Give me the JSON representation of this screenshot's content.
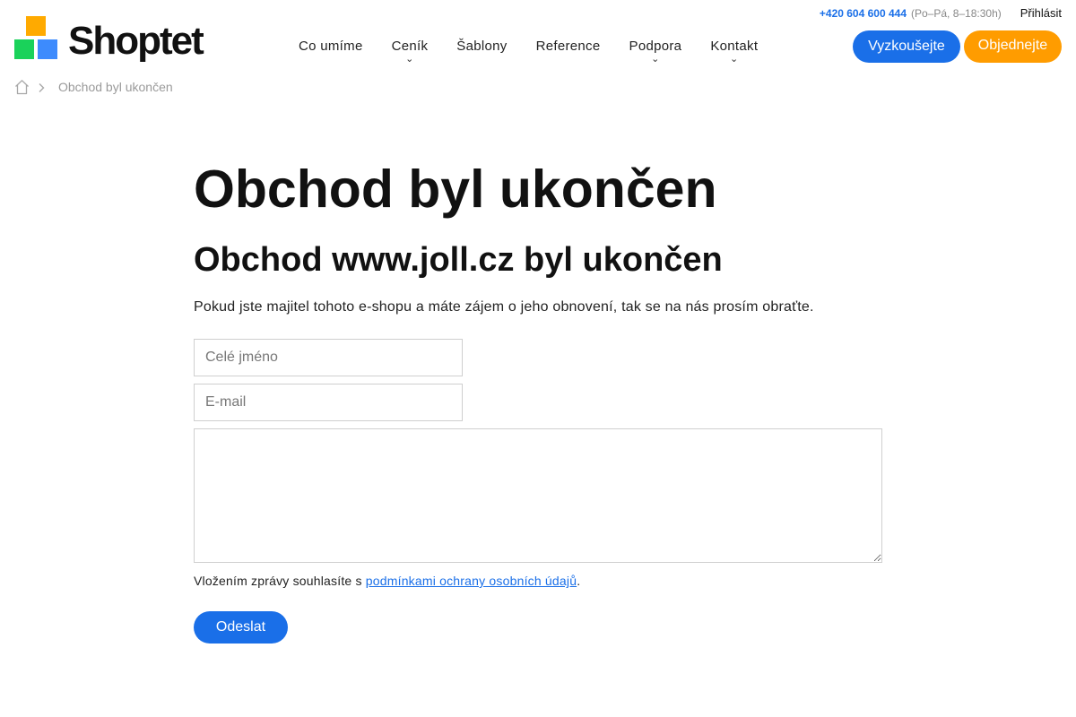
{
  "header": {
    "phone": "+420 604 600 444",
    "hours": "(Po–Pá, 8–18:30h)",
    "login": "Přihlásit",
    "logo_text": "Shoptet",
    "try_button": "Vyzkoušejte",
    "order_button": "Objednejte",
    "brand_colors": {
      "orange": "#ffaa00",
      "green": "#1ad25a",
      "blue": "#3d8bfd"
    }
  },
  "nav": {
    "items": [
      {
        "label": "Co umíme",
        "has_dropdown": false
      },
      {
        "label": "Ceník",
        "has_dropdown": true
      },
      {
        "label": "Šablony",
        "has_dropdown": false
      },
      {
        "label": "Reference",
        "has_dropdown": false
      },
      {
        "label": "Podpora",
        "has_dropdown": true
      },
      {
        "label": "Kontakt",
        "has_dropdown": true
      }
    ]
  },
  "breadcrumb": {
    "home_icon": "home-icon",
    "current": "Obchod byl ukončen"
  },
  "main": {
    "title": "Obchod byl ukončen",
    "subtitle": "Obchod www.joll.cz byl ukončen",
    "intro": "Pokud jste majitel tohoto e-shopu a máte zájem o jeho obnovení, tak se na nás prosím obraťte.",
    "form": {
      "name_placeholder": "Celé jméno",
      "name_value": "",
      "email_placeholder": "E-mail",
      "email_value": "",
      "message_value": "",
      "consent_prefix": "Vložením zprávy souhlasíte s ",
      "consent_link": "podmínkami ochrany osobních údajů",
      "consent_suffix": ".",
      "submit_label": "Odeslat"
    }
  },
  "colors": {
    "accent_blue": "#1a6fe8",
    "accent_orange": "#ff9c00"
  }
}
